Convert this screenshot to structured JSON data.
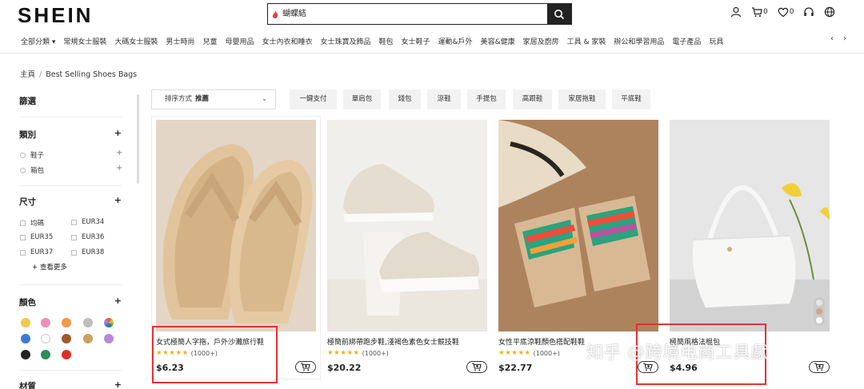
{
  "header": {
    "logo": "SHEIN",
    "search_query": "蝴蝶結",
    "counts": {
      "cart": "0",
      "wishlist": "0"
    }
  },
  "nav": {
    "items": [
      "全部分類 ▾",
      "常規女士服裝",
      "大碼女士服裝",
      "男士時尚",
      "兒童",
      "母嬰用品",
      "女士內衣和睡衣",
      "女士珠寶及飾品",
      "鞋包",
      "女士鞋子",
      "運動&戶外",
      "美容&健康",
      "家居及廚房",
      "工具 & 家裝",
      "辦公和學習用品",
      "電子產品",
      "玩具"
    ]
  },
  "breadcrumb": {
    "home": "主頁",
    "current": "Best Selling Shoes Bags"
  },
  "sidebar": {
    "filter_title": "篩選",
    "category": {
      "title": "類別",
      "options": [
        "鞋子",
        "箱包"
      ]
    },
    "size": {
      "title": "尺寸",
      "options": [
        "均碼",
        "EUR34",
        "EUR35",
        "EUR36",
        "EUR37",
        "EUR38"
      ],
      "more": "+ 查看更多"
    },
    "color": {
      "title": "顏色",
      "swatches": [
        "#f2c94c",
        "#f08fb4",
        "#f2994a",
        "#bdbdbd",
        "#f2c94c",
        "#3b7bd3",
        "#ffffff",
        "#9c5a2c",
        "#c8a25b",
        "#b88ad8",
        "#222222",
        "#2e8b57",
        "#d93025"
      ]
    },
    "material": {
      "title": "材質"
    }
  },
  "toolbar": {
    "sort_label": "排序方式",
    "sort_value": "推薦",
    "chips": [
      "一鍵支付",
      "單肩包",
      "錢包",
      "涼鞋",
      "手提包",
      "高跟鞋",
      "家居拖鞋",
      "平底鞋"
    ]
  },
  "products": [
    {
      "title": "女式極簡人字拖，戶外沙灘旅行鞋",
      "stars": "★★★★★",
      "reviews": "(1000+)",
      "price": "$6.23"
    },
    {
      "title": "極簡前綁帶跑步鞋,淺褐色素色女士競技鞋",
      "stars": "★★★★★",
      "reviews": "(1000+)",
      "price": "$20.22"
    },
    {
      "title": "女性平底涼鞋顏色搭配鞋鞋",
      "stars": "★★★★★",
      "reviews": "(1000+)",
      "price": "$22.77"
    },
    {
      "title": "極簡風格法棍包",
      "stars": "",
      "reviews": "",
      "price": "$4.96"
    }
  ],
  "watermark": "知乎 @跨境电商工具獻",
  "colors": {
    "highlight": "#e5322d",
    "star": "#f2b01e",
    "accent": "#222222"
  }
}
